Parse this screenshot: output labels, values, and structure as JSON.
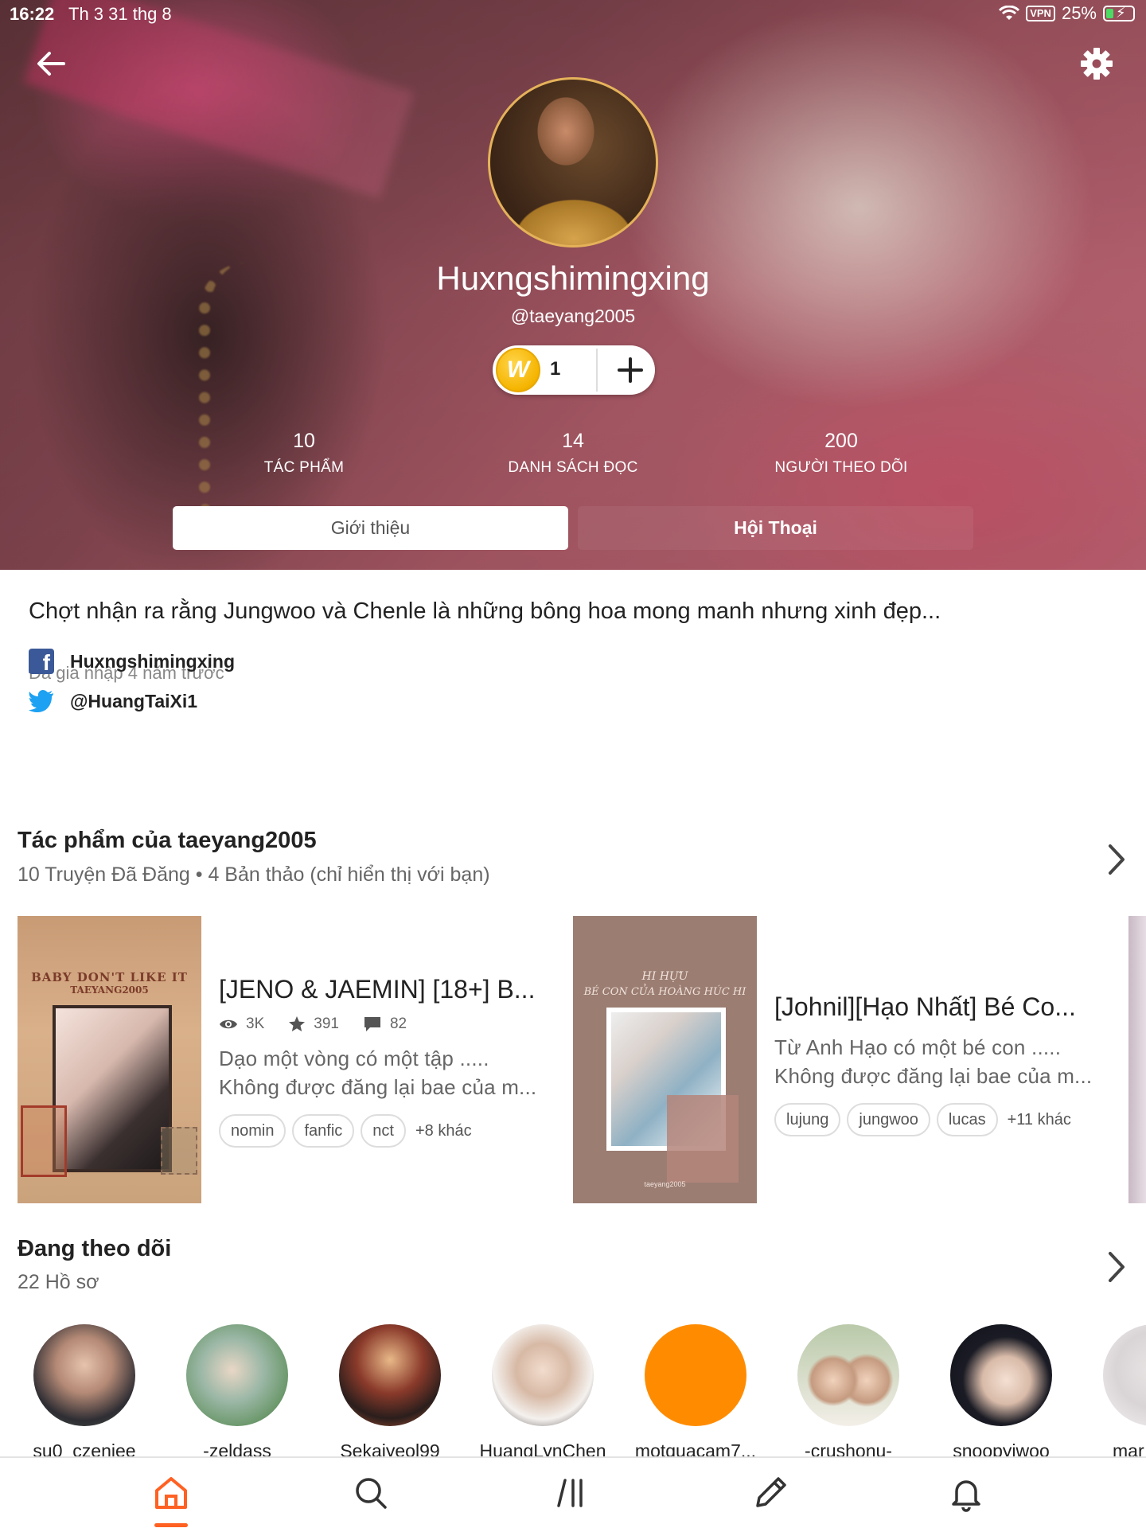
{
  "status_bar": {
    "time": "16:22",
    "date": "Th 3 31 thg 8",
    "vpn": "VPN",
    "battery": "25%"
  },
  "profile": {
    "display_name": "Huxngshimingxing",
    "username": "@taeyang2005",
    "coins": "1",
    "coin_symbol": "W"
  },
  "stats": [
    {
      "value": "10",
      "label": "TÁC PHẨM"
    },
    {
      "value": "14",
      "label": "DANH SÁCH ĐỌC"
    },
    {
      "value": "200",
      "label": "NGƯỜI THEO DÕI"
    }
  ],
  "tabs": {
    "about": "Giới thiệu",
    "conversation": "Hội Thoại"
  },
  "about": {
    "bio": "Chợt nhận ra rằng Jungwoo và Chenle là những bông hoa mong manh nhưng xinh đẹp...",
    "joined": "Đã gia nhập 4 năm trước",
    "facebook": "Huxngshimingxing",
    "twitter": "@HuangTaiXi1"
  },
  "works": {
    "title": "Tác phẩm của taeyang2005",
    "subtitle": "10 Truyện Đã Đăng • 4 Bản thảo (chỉ hiển thị với bạn)",
    "stories": [
      {
        "title": "[JENO & JAEMIN] [18+] B...",
        "cover_title": "BABY DON'T LIKE IT",
        "cover_sub": "TAEYANG2005",
        "reads": "3K",
        "votes": "391",
        "comments": "82",
        "desc1": "Dạo một vòng có một tập .....",
        "desc2": "Không được đăng lại bae của m...",
        "tags": [
          "nomin",
          "fanfic",
          "nct"
        ],
        "more_tags": "+8 khác"
      },
      {
        "title": "[Johnil][Hạo Nhất] Bé Co...",
        "cover_title": "HI HỰU",
        "cover_sub": "BÉ CON CỦA HOÀNG HÚC HI",
        "cover_foot": "taeyang2005",
        "desc1": "Từ Anh Hạo có một bé con .....",
        "desc2": "Không được đăng lại bae của m...",
        "tags": [
          "lujung",
          "jungwoo",
          "lucas"
        ],
        "more_tags": "+11 khác"
      }
    ]
  },
  "following": {
    "title": "Đang theo dõi",
    "subtitle": "22 Hồ sơ",
    "users": [
      {
        "name": "su0_czeniee"
      },
      {
        "name": "-zeldass"
      },
      {
        "name": "Sekaiyeol99"
      },
      {
        "name": "HuangLynChen"
      },
      {
        "name": "motquacam7..."
      },
      {
        "name": "-crushonu-"
      },
      {
        "name": "snoopyjwoo"
      },
      {
        "name": "mar"
      }
    ]
  },
  "colors": {
    "accent": "#ff6122",
    "coin": "#f5b400",
    "facebook": "#3b5998",
    "twitter": "#1da1f2"
  },
  "icons": [
    "back-arrow-icon",
    "gear-icon",
    "plus-icon",
    "eye-icon",
    "star-icon",
    "comment-icon",
    "chevron-right-icon",
    "home-icon",
    "search-icon",
    "library-icon",
    "pencil-icon",
    "bell-icon"
  ]
}
